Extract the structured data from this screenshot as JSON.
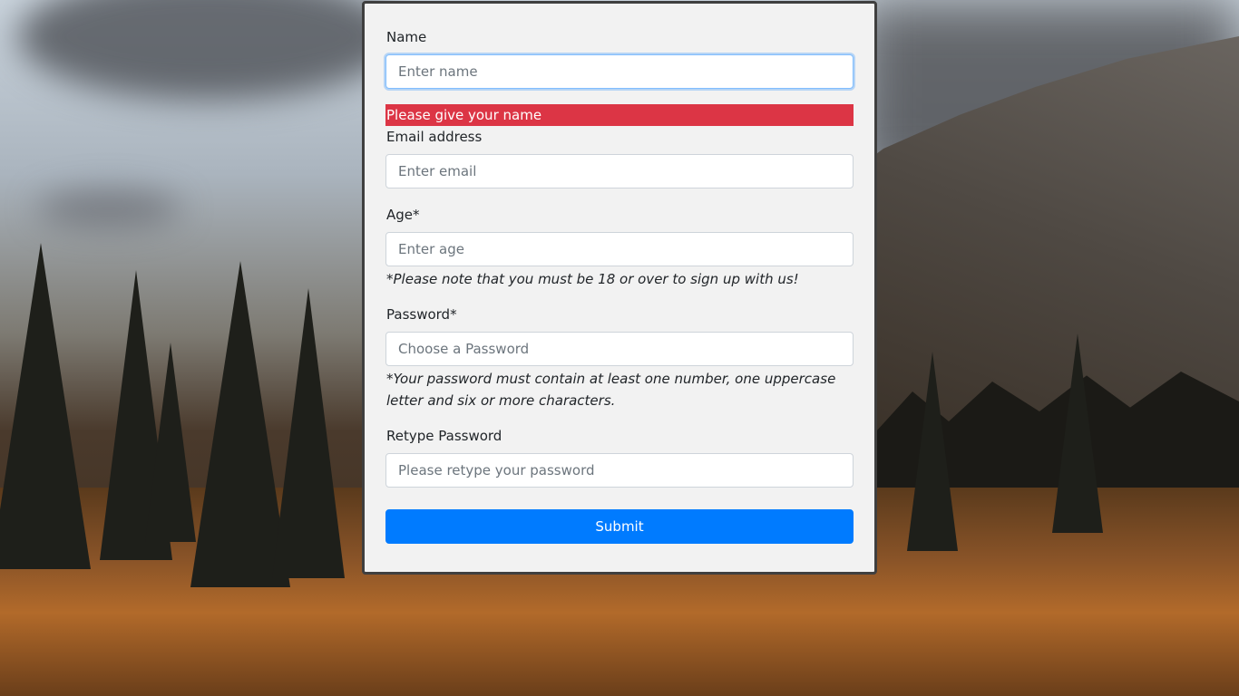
{
  "form": {
    "name": {
      "label": "Name",
      "placeholder": "Enter name",
      "value": ""
    },
    "name_error": "Please give your name",
    "email": {
      "label": "Email address",
      "placeholder": "Enter email",
      "value": ""
    },
    "age": {
      "label": "Age*",
      "placeholder": "Enter age",
      "value": "",
      "note": "*Please note that you must be 18 or over to sign up with us!"
    },
    "password": {
      "label": "Password*",
      "placeholder": "Choose a Password",
      "value": "",
      "note": "*Your password must contain at least one number, one uppercase letter and six or more characters."
    },
    "retype": {
      "label": "Retype Password",
      "placeholder": "Please retype your password",
      "value": ""
    },
    "submit_label": "Submit"
  },
  "colors": {
    "card_background": "#f2f2f2",
    "error": "#dc3545",
    "primary": "#007bff"
  }
}
